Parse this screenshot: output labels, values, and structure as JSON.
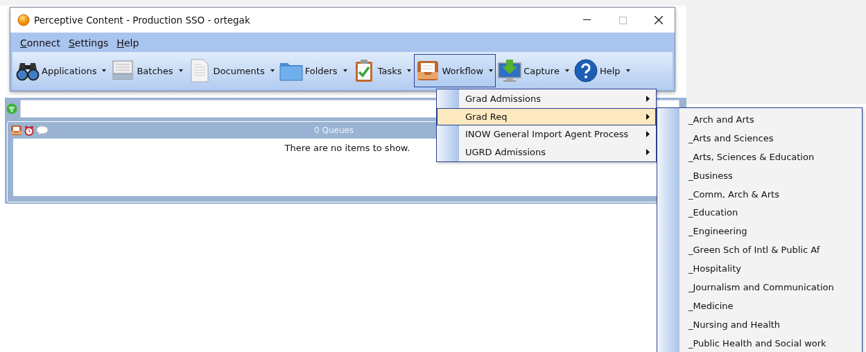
{
  "window": {
    "title": "Perceptive Content - Production SSO - ortegak"
  },
  "menu_bar": [
    {
      "label": "Connect"
    },
    {
      "label": "Settings"
    },
    {
      "label": "Help"
    }
  ],
  "toolbar": [
    {
      "label": "Applications",
      "selected": false
    },
    {
      "label": "Batches",
      "selected": false
    },
    {
      "label": "Documents",
      "selected": false
    },
    {
      "label": "Folders",
      "selected": false
    },
    {
      "label": "Tasks",
      "selected": false
    },
    {
      "label": "Workflow",
      "selected": true
    },
    {
      "label": "Capture",
      "selected": false
    },
    {
      "label": "Help",
      "selected": false
    }
  ],
  "queues_panel": {
    "header": "0 Queues",
    "empty_message": "There are no items to show."
  },
  "workflow_menu": [
    {
      "label": "Grad Admissions",
      "selected": false
    },
    {
      "label": "Grad Req",
      "selected": true
    },
    {
      "label": "INOW General Import Agent Process",
      "selected": false
    },
    {
      "label": "UGRD Admissions",
      "selected": false
    }
  ],
  "submenu": [
    "_Arch and Arts",
    "_Arts and Sciences",
    "_Arts, Sciences & Education",
    "_Business",
    "_Comm, Arch & Arts",
    "_Education",
    "_Engineering",
    "_Green Sch of Intl & Public Af",
    "_Hospitality",
    "_Journalism and Communication",
    "_Medicine",
    "_Nursing and Health",
    "_Public Health and Social work"
  ]
}
